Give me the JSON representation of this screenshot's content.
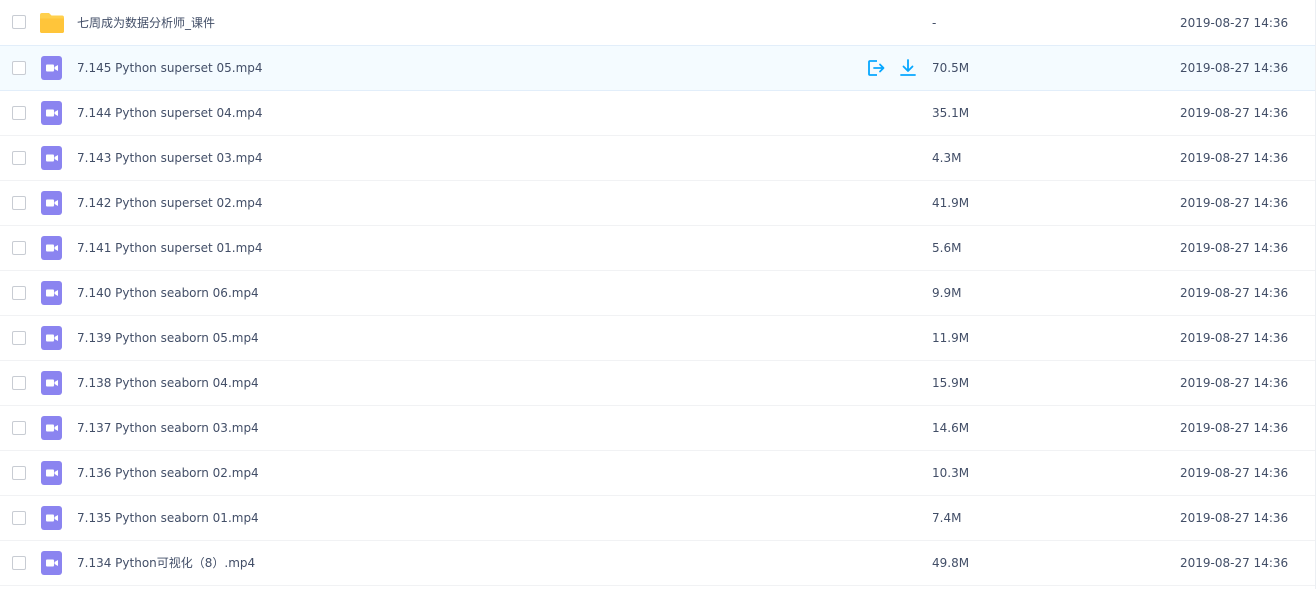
{
  "colors": {
    "folder": "#ffd04d",
    "video": "#8b84f0",
    "action": "#06a7ff",
    "text": "#424e67",
    "hover_bg": "#f4fbff"
  },
  "rows": [
    {
      "type": "folder",
      "icon": "folder-icon",
      "name": "七周成为数据分析师_课件",
      "size": "-",
      "date": "2019-08-27 14:36"
    },
    {
      "type": "video",
      "icon": "video-file-icon",
      "name": "7.145 Python superset 05.mp4",
      "size": "70.5M",
      "date": "2019-08-27 14:36",
      "hover": true,
      "actions": [
        "share-icon",
        "download-icon"
      ]
    },
    {
      "type": "video",
      "icon": "video-file-icon",
      "name": "7.144 Python superset 04.mp4",
      "size": "35.1M",
      "date": "2019-08-27 14:36"
    },
    {
      "type": "video",
      "icon": "video-file-icon",
      "name": "7.143 Python superset 03.mp4",
      "size": "4.3M",
      "date": "2019-08-27 14:36"
    },
    {
      "type": "video",
      "icon": "video-file-icon",
      "name": "7.142 Python superset 02.mp4",
      "size": "41.9M",
      "date": "2019-08-27 14:36"
    },
    {
      "type": "video",
      "icon": "video-file-icon",
      "name": "7.141 Python superset 01.mp4",
      "size": "5.6M",
      "date": "2019-08-27 14:36"
    },
    {
      "type": "video",
      "icon": "video-file-icon",
      "name": "7.140 Python seaborn 06.mp4",
      "size": "9.9M",
      "date": "2019-08-27 14:36"
    },
    {
      "type": "video",
      "icon": "video-file-icon",
      "name": "7.139 Python seaborn 05.mp4",
      "size": "11.9M",
      "date": "2019-08-27 14:36"
    },
    {
      "type": "video",
      "icon": "video-file-icon",
      "name": "7.138 Python seaborn 04.mp4",
      "size": "15.9M",
      "date": "2019-08-27 14:36"
    },
    {
      "type": "video",
      "icon": "video-file-icon",
      "name": "7.137 Python seaborn 03.mp4",
      "size": "14.6M",
      "date": "2019-08-27 14:36"
    },
    {
      "type": "video",
      "icon": "video-file-icon",
      "name": "7.136 Python seaborn 02.mp4",
      "size": "10.3M",
      "date": "2019-08-27 14:36"
    },
    {
      "type": "video",
      "icon": "video-file-icon",
      "name": "7.135 Python seaborn 01.mp4",
      "size": "7.4M",
      "date": "2019-08-27 14:36"
    },
    {
      "type": "video",
      "icon": "video-file-icon",
      "name": "7.134 Python可视化（8）.mp4",
      "size": "49.8M",
      "date": "2019-08-27 14:36"
    }
  ]
}
